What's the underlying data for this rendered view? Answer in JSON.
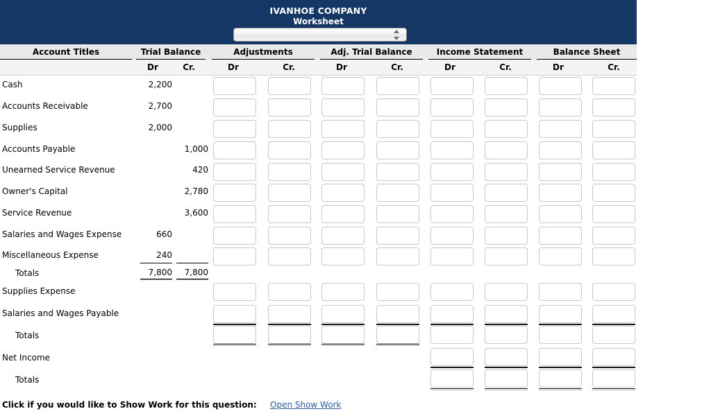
{
  "banner": {
    "company": "IVANHOE COMPANY",
    "subtitle": "Worksheet",
    "period_select_value": "",
    "period_select_placeholder": "",
    "background_color": "#153765"
  },
  "table": {
    "column_groups": [
      {
        "label": "Account Titles",
        "sub": []
      },
      {
        "label": "Trial Balance",
        "sub": [
          "Dr",
          "Cr."
        ]
      },
      {
        "label": "Adjustments",
        "sub": [
          "Dr",
          "Cr."
        ]
      },
      {
        "label": "Adj. Trial Balance",
        "sub": [
          "Dr",
          "Cr."
        ]
      },
      {
        "label": "Income Statement",
        "sub": [
          "Dr",
          "Cr."
        ]
      },
      {
        "label": "Balance Sheet",
        "sub": [
          "Dr",
          "Cr."
        ]
      }
    ],
    "rows": [
      {
        "title": "Cash",
        "tb_dr": "2,200",
        "tb_cr": ""
      },
      {
        "title": "Accounts Receivable",
        "tb_dr": "2,700",
        "tb_cr": ""
      },
      {
        "title": "Supplies",
        "tb_dr": "2,000",
        "tb_cr": ""
      },
      {
        "title": "Accounts Payable",
        "tb_dr": "",
        "tb_cr": "1,000"
      },
      {
        "title": "Unearned Service Revenue",
        "tb_dr": "",
        "tb_cr": "420"
      },
      {
        "title": "Owner's Capital",
        "tb_dr": "",
        "tb_cr": "2,780"
      },
      {
        "title": "Service Revenue",
        "tb_dr": "",
        "tb_cr": "3,600"
      },
      {
        "title": "Salaries and Wages Expense",
        "tb_dr": "660",
        "tb_cr": ""
      },
      {
        "title": "Miscellaneous Expense",
        "tb_dr": "240",
        "tb_cr": ""
      },
      {
        "title": "Totals",
        "tb_dr": "7,800",
        "tb_cr": "7,800"
      },
      {
        "title": "Supplies Expense",
        "tb_dr": "",
        "tb_cr": ""
      },
      {
        "title": "Salaries and Wages Payable",
        "tb_dr": "",
        "tb_cr": ""
      },
      {
        "title": "Totals",
        "tb_dr": "",
        "tb_cr": ""
      },
      {
        "title": "Net Income",
        "tb_dr": "",
        "tb_cr": ""
      },
      {
        "title": "Totals",
        "tb_dr": "",
        "tb_cr": ""
      }
    ],
    "input_values": {
      "r0": [
        "",
        "",
        "",
        "",
        "",
        "",
        "",
        ""
      ],
      "r1": [
        "",
        "",
        "",
        "",
        "",
        "",
        "",
        ""
      ],
      "r2": [
        "",
        "",
        "",
        "",
        "",
        "",
        "",
        ""
      ],
      "r3": [
        "",
        "",
        "",
        "",
        "",
        "",
        "",
        ""
      ],
      "r4": [
        "",
        "",
        "",
        "",
        "",
        "",
        "",
        ""
      ],
      "r5": [
        "",
        "",
        "",
        "",
        "",
        "",
        "",
        ""
      ],
      "r6": [
        "",
        "",
        "",
        "",
        "",
        "",
        "",
        ""
      ],
      "r7": [
        "",
        "",
        "",
        "",
        "",
        "",
        "",
        ""
      ],
      "r8": [
        "",
        "",
        "",
        "",
        "",
        "",
        "",
        ""
      ],
      "r10": [
        "",
        "",
        "",
        "",
        "",
        "",
        "",
        ""
      ],
      "r11": [
        "",
        "",
        "",
        "",
        "",
        "",
        "",
        ""
      ],
      "r12": [
        "",
        "",
        "",
        "",
        "",
        "",
        "",
        ""
      ],
      "r13": [
        "",
        "",
        "",
        ""
      ],
      "r14": [
        "",
        "",
        "",
        ""
      ]
    }
  },
  "footer": {
    "text": "Click if you would like to Show Work for this question:",
    "link_label": "Open Show Work",
    "link_color": "#2b5c9e"
  }
}
